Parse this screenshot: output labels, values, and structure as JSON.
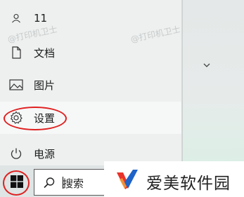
{
  "start_menu": {
    "user": {
      "label": "11",
      "icon": "user-icon"
    },
    "items": [
      {
        "label": "文档",
        "icon": "document-icon"
      },
      {
        "label": "图片",
        "icon": "picture-icon"
      },
      {
        "label": "设置",
        "icon": "gear-icon"
      },
      {
        "label": "电源",
        "icon": "power-icon"
      }
    ],
    "expand_icon": "chevron-down-icon"
  },
  "taskbar": {
    "start_icon": "windows-logo-icon",
    "search": {
      "text": "搜索",
      "icon": "search-icon"
    }
  },
  "watermark": {
    "text": "@打印机卫士"
  },
  "brand": {
    "name": "爱美软件园",
    "logo": "brand-logo"
  },
  "colors": {
    "annotation": "#e02020",
    "brand_red": "#e8332a",
    "brand_blue": "#1e63c8"
  }
}
